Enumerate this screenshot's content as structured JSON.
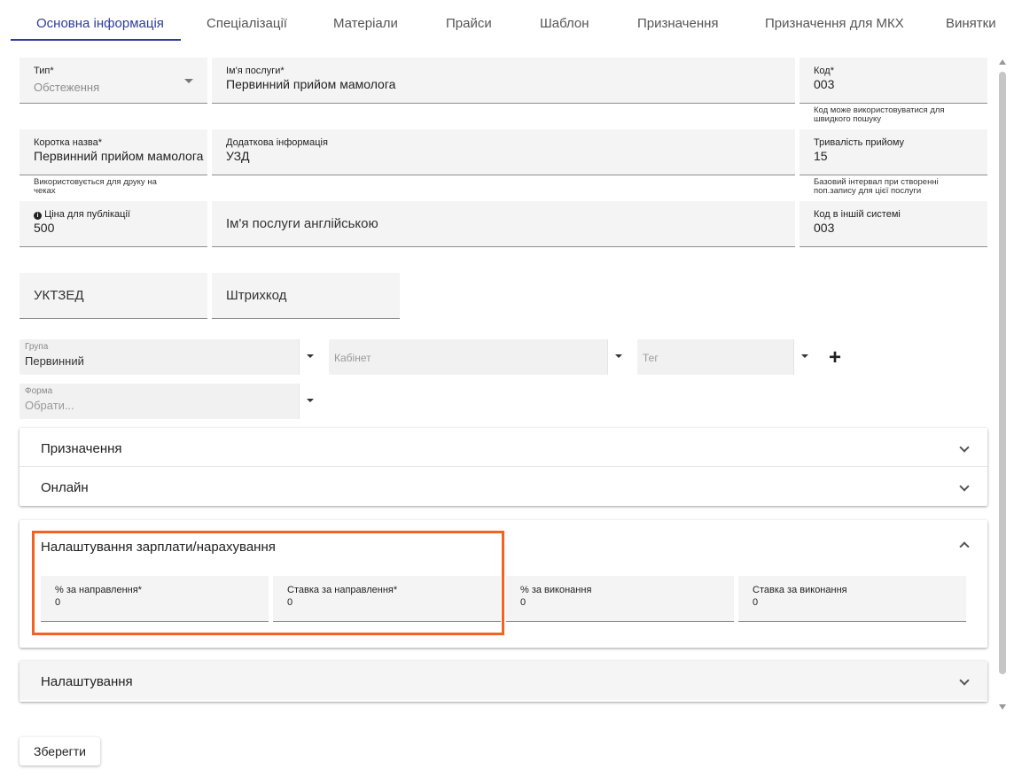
{
  "tabs": [
    {
      "label": "Основна інформація",
      "active": true
    },
    {
      "label": "Спеціалізації"
    },
    {
      "label": "Матеріали"
    },
    {
      "label": "Прайси"
    },
    {
      "label": "Шаблон"
    },
    {
      "label": "Призначення"
    },
    {
      "label": "Призначення для МКХ"
    },
    {
      "label": "Винятки"
    }
  ],
  "form": {
    "type": {
      "label": "Тип*",
      "value": "Обстеження"
    },
    "service_name": {
      "label": "Ім'я послуги*",
      "value": "Первинний прийом мамолога"
    },
    "code": {
      "label": "Код*",
      "value": "003",
      "hint": "Код може використовуватися для швидкого пошуку"
    },
    "short_name": {
      "label": "Коротка назва*",
      "value": "Первинний прийом мамолога",
      "hint": "Використовується для друку на чеках"
    },
    "additional_info": {
      "label": "Додаткова інформація",
      "value": "УЗД"
    },
    "duration": {
      "label": "Тривалість прийому",
      "value": "15",
      "hint": "Базовий інтервал при створенні поп.запису для цієї послуги"
    },
    "price": {
      "label": "Ціна для публікації",
      "value": "500"
    },
    "english_name": {
      "placeholder": "Ім'я послуги англійською"
    },
    "external_code": {
      "label": "Код в іншій системі",
      "value": "003"
    },
    "uktzed": {
      "placeholder": "УКТЗЕД"
    },
    "barcode": {
      "placeholder": "Штрихкод"
    },
    "group": {
      "label": "Група",
      "value": "Первинний"
    },
    "cabinet": {
      "placeholder": "Кабінет"
    },
    "tag": {
      "placeholder": "Тег"
    },
    "form_select": {
      "label": "Форма",
      "placeholder": "Обрати..."
    }
  },
  "panels": {
    "assignment": "Призначення",
    "online": "Онлайн",
    "salary": {
      "title": "Налаштування зарплати/нарахування",
      "fields": [
        {
          "label": "% за направлення*",
          "value": "0"
        },
        {
          "label": "Ставка за направлення*",
          "value": "0"
        },
        {
          "label": "% за виконання",
          "value": "0"
        },
        {
          "label": "Ставка за виконання",
          "value": "0"
        }
      ]
    },
    "settings": "Налаштування"
  },
  "actions": {
    "save": "Зберегти"
  },
  "colors": {
    "accent": "#2f3c9c",
    "highlight": "#f26322"
  }
}
